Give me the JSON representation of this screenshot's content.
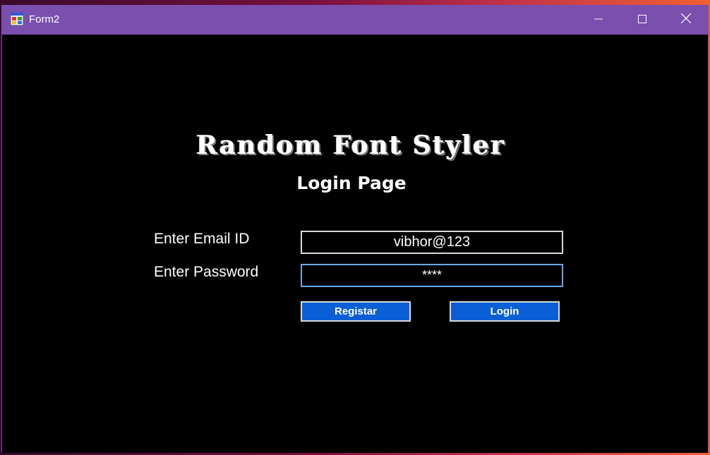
{
  "window": {
    "title": "Form2",
    "controls": {
      "minimize": "minimize",
      "maximize": "maximize",
      "close": "close"
    }
  },
  "app": {
    "title": "Random Font Styler",
    "subtitle": "Login Page"
  },
  "form": {
    "email_label": "Enter Email ID",
    "email_value": "vibhor@123",
    "password_label": "Enter Password",
    "password_value": "****",
    "register_label": "Registar",
    "login_label": "Login"
  },
  "colors": {
    "titlebar": "#7a4fae",
    "background": "#000000",
    "button": "#0a5fd6",
    "focus_border": "#6aa8e8"
  },
  "icons": {
    "app": "form-app-icon",
    "minimize": "minimize-icon",
    "maximize": "maximize-icon",
    "close": "close-icon"
  }
}
